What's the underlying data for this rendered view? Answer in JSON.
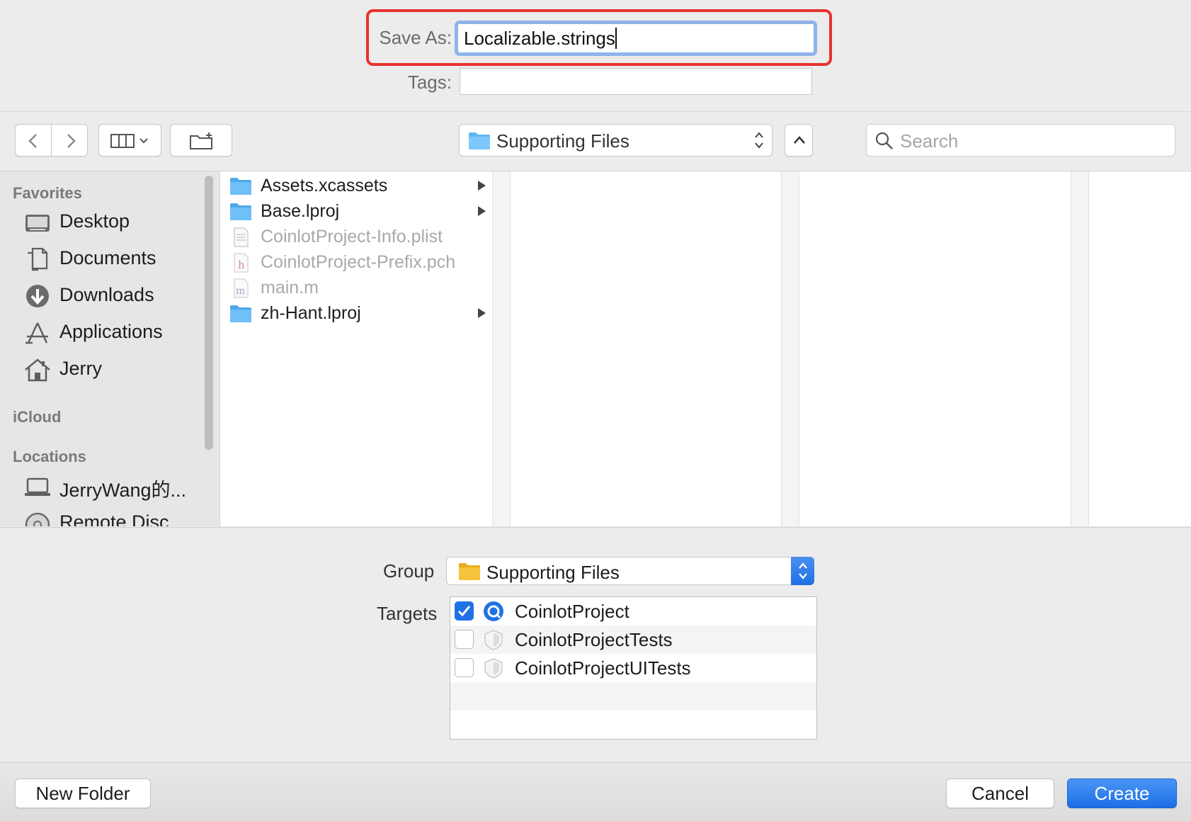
{
  "save_as": {
    "label": "Save As:",
    "value": "Localizable.strings"
  },
  "tags": {
    "label": "Tags:",
    "value": ""
  },
  "toolbar": {
    "location": "Supporting Files",
    "search_placeholder": "Search"
  },
  "sidebar": {
    "favorites_header": "Favorites",
    "favorites": [
      {
        "label": "Desktop",
        "icon": "desktop-icon"
      },
      {
        "label": "Documents",
        "icon": "documents-icon"
      },
      {
        "label": "Downloads",
        "icon": "downloads-icon"
      },
      {
        "label": "Applications",
        "icon": "applications-icon"
      },
      {
        "label": "Jerry",
        "icon": "home-icon"
      }
    ],
    "icloud_header": "iCloud",
    "locations_header": "Locations",
    "locations": [
      {
        "label": "JerryWang的...",
        "icon": "laptop-icon"
      },
      {
        "label": "Remote Disc",
        "icon": "disc-icon"
      }
    ]
  },
  "files": [
    {
      "name": "Assets.xcassets",
      "kind": "folder",
      "enabled": true,
      "has_children": true
    },
    {
      "name": "Base.lproj",
      "kind": "folder",
      "enabled": true,
      "has_children": true
    },
    {
      "name": "CoinlotProject-Info.plist",
      "kind": "plist",
      "enabled": false,
      "has_children": false
    },
    {
      "name": "CoinlotProject-Prefix.pch",
      "kind": "h",
      "enabled": false,
      "has_children": false
    },
    {
      "name": "main.m",
      "kind": "m",
      "enabled": false,
      "has_children": false
    },
    {
      "name": "zh-Hant.lproj",
      "kind": "folder",
      "enabled": true,
      "has_children": true
    }
  ],
  "accessory": {
    "group_label": "Group",
    "group_value": "Supporting Files",
    "targets_label": "Targets",
    "targets": [
      {
        "name": "CoinlotProject",
        "checked": true,
        "icon": "app-target-icon"
      },
      {
        "name": "CoinlotProjectTests",
        "checked": false,
        "icon": "test-target-icon"
      },
      {
        "name": "CoinlotProjectUITests",
        "checked": false,
        "icon": "test-target-icon"
      }
    ]
  },
  "buttons": {
    "new_folder": "New Folder",
    "cancel": "Cancel",
    "create": "Create"
  },
  "colors": {
    "highlight": "#e8322f",
    "accent": "#1f72e6",
    "folder_blue": "#5eb7f5",
    "folder_yellow": "#f7c33c"
  }
}
